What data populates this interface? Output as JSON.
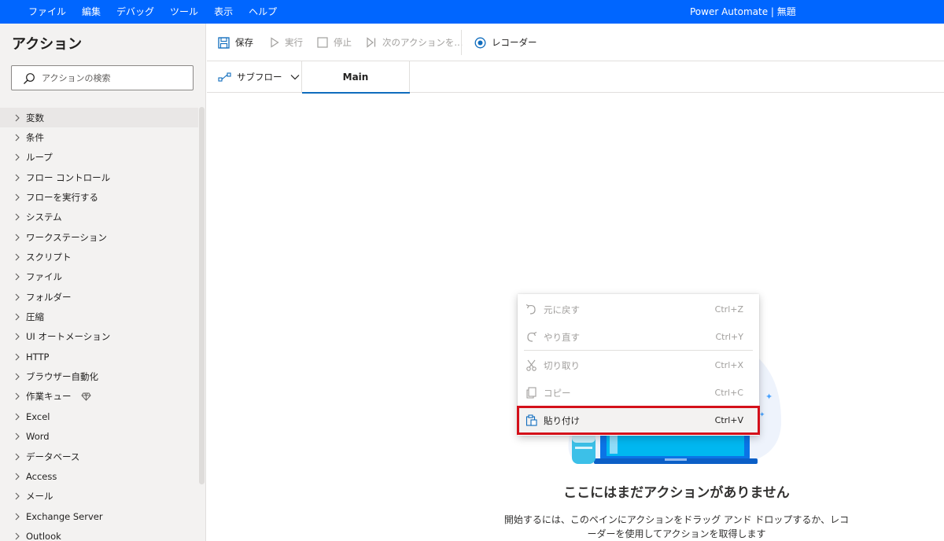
{
  "menu": {
    "items": [
      "ファイル",
      "編集",
      "デバッグ",
      "ツール",
      "表示",
      "ヘルプ"
    ],
    "app_title": "Power Automate | 無題"
  },
  "sidebar": {
    "title": "アクション",
    "search_placeholder": "アクションの検索",
    "items": [
      {
        "label": "変数"
      },
      {
        "label": "条件"
      },
      {
        "label": "ループ"
      },
      {
        "label": "フロー コントロール"
      },
      {
        "label": "フローを実行する"
      },
      {
        "label": "システム"
      },
      {
        "label": "ワークステーション"
      },
      {
        "label": "スクリプト"
      },
      {
        "label": "ファイル"
      },
      {
        "label": "フォルダー"
      },
      {
        "label": "圧縮"
      },
      {
        "label": "UI オートメーション"
      },
      {
        "label": "HTTP"
      },
      {
        "label": "ブラウザー自動化"
      },
      {
        "label": "作業キュー"
      },
      {
        "label": "Excel"
      },
      {
        "label": "Word"
      },
      {
        "label": "データベース"
      },
      {
        "label": "Access"
      },
      {
        "label": "メール"
      },
      {
        "label": "Exchange Server"
      },
      {
        "label": "Outlook"
      }
    ]
  },
  "toolbar": {
    "save": "保存",
    "run": "実行",
    "stop": "停止",
    "next_action": "次のアクションを...",
    "recorder": "レコーダー"
  },
  "tabs": {
    "subflow": "サブフロー",
    "main": "Main"
  },
  "context_menu": {
    "undo": {
      "label": "元に戻す",
      "shortcut": "Ctrl+Z"
    },
    "redo": {
      "label": "やり直す",
      "shortcut": "Ctrl+Y"
    },
    "cut": {
      "label": "切り取り",
      "shortcut": "Ctrl+X"
    },
    "copy": {
      "label": "コピー",
      "shortcut": "Ctrl+C"
    },
    "paste": {
      "label": "貼り付け",
      "shortcut": "Ctrl+V"
    }
  },
  "empty_state": {
    "title": "ここにはまだアクションがありません",
    "description": "開始するには、このペインにアクションをドラッグ アンド ドロップするか、レコーダーを使用してアクションを取得します"
  },
  "colors": {
    "titlebar": "#0066ff",
    "accent": "#0f6cbd",
    "highlight_border": "#d4101a"
  }
}
